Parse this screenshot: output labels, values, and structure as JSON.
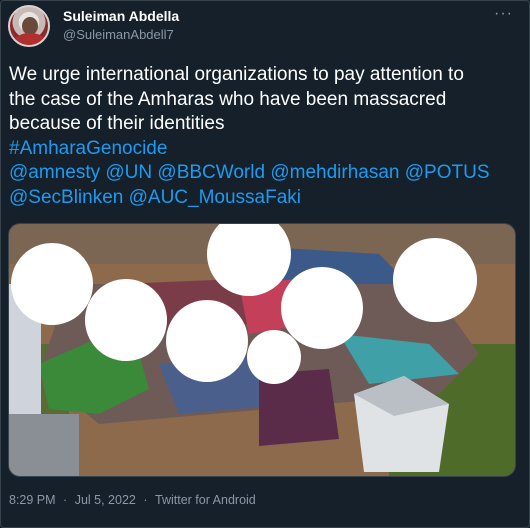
{
  "tweet": {
    "author": {
      "name": "Suleiman Abdella",
      "handle": "@SuleimanAbdell7"
    },
    "more_glyph": "···",
    "text_lines": [
      "We urge international organizations to pay attention to",
      "the case of the Amharas who have been massacred",
      "because of their identities"
    ],
    "hashtag": "#AmharaGenocide",
    "mentions_line1": [
      "@amnesty",
      "@UN",
      "@BBCWorld",
      "@mehdirhasan",
      "@POTUS"
    ],
    "mentions_line2": [
      "@SecBlinken",
      "@AUC_MoussaFaki"
    ],
    "time": "8:29 PM",
    "date": "Jul 5, 2022",
    "separator": "·",
    "source": "Twitter for Android"
  },
  "colors": {
    "background": "#15202b",
    "text": "#ffffff",
    "muted": "#8b98a5",
    "link": "#1d9bf0",
    "border": "#38444d"
  }
}
